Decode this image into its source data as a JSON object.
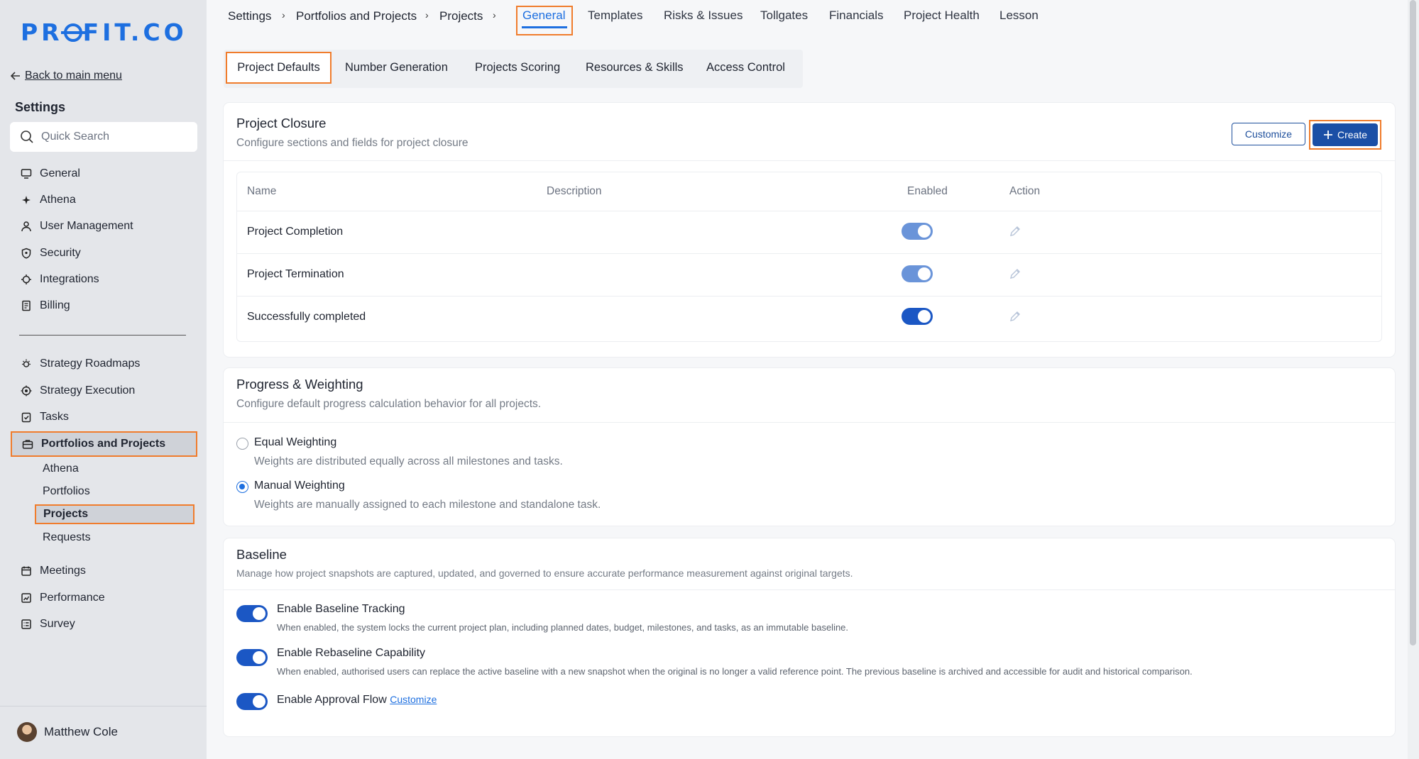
{
  "brand": {
    "logo_text_pre": "PR",
    "logo_text_post": "FIT.CO"
  },
  "sidebar": {
    "back_label": "Back to main menu",
    "title": "Settings",
    "search_placeholder": "Quick Search",
    "items": [
      {
        "label": "General",
        "icon": "monitor-icon"
      },
      {
        "label": "Athena",
        "icon": "sparkle-icon"
      },
      {
        "label": "User Management",
        "icon": "user-icon"
      },
      {
        "label": "Security",
        "icon": "shield-icon"
      },
      {
        "label": "Integrations",
        "icon": "gear-icon"
      },
      {
        "label": "Billing",
        "icon": "receipt-icon"
      }
    ],
    "items2": [
      {
        "label": "Strategy Roadmaps",
        "icon": "lightbulb-icon"
      },
      {
        "label": "Strategy Execution",
        "icon": "target-icon"
      },
      {
        "label": "Tasks",
        "icon": "checklist-icon"
      },
      {
        "label": "Portfolios and Projects",
        "icon": "briefcase-icon"
      }
    ],
    "sub_items": [
      "Athena",
      "Portfolios",
      "Projects",
      "Requests"
    ],
    "items3": [
      {
        "label": "Meetings",
        "icon": "calendar-icon"
      },
      {
        "label": "Performance",
        "icon": "chart-icon"
      },
      {
        "label": "Survey",
        "icon": "survey-icon"
      }
    ],
    "user_name": "Matthew Cole"
  },
  "breadcrumb": [
    "Settings",
    "Portfolios and Projects",
    "Projects"
  ],
  "top_tabs": [
    "General",
    "Templates",
    "Risks & Issues",
    "Tollgates",
    "Financials",
    "Project Health",
    "Lesson"
  ],
  "sub_tabs": [
    "Project Defaults",
    "Number Generation",
    "Projects Scoring",
    "Resources & Skills",
    "Access Control"
  ],
  "closure": {
    "title": "Project Closure",
    "subtitle": "Configure sections and fields for project closure",
    "customize_label": "Customize",
    "create_label": "Create",
    "columns": [
      "Name",
      "Description",
      "Enabled",
      "Action"
    ],
    "rows": [
      {
        "name": "Project Completion",
        "description": "",
        "enabled": true
      },
      {
        "name": "Project Termination",
        "description": "",
        "enabled": true
      },
      {
        "name": "Successfully completed",
        "description": "",
        "enabled": true
      }
    ]
  },
  "progress": {
    "title": "Progress & Weighting",
    "subtitle": "Configure default progress calculation behavior for all projects.",
    "options": [
      {
        "label": "Equal Weighting",
        "desc": "Weights are distributed equally across all milestones and tasks.",
        "selected": false
      },
      {
        "label": "Manual Weighting",
        "desc": "Weights are manually assigned to each milestone and standalone task.",
        "selected": true
      }
    ]
  },
  "baseline": {
    "title": "Baseline",
    "subtitle": "Manage how project snapshots are captured, updated, and governed to ensure accurate performance measurement against original targets.",
    "settings": [
      {
        "label": "Enable Baseline Tracking",
        "desc": "When enabled, the system locks the current project plan, including planned dates, budget, milestones, and tasks, as an immutable baseline.",
        "enabled": true
      },
      {
        "label": "Enable Rebaseline Capability",
        "desc": "When enabled, authorised users can replace the active baseline with a new snapshot when the original is no longer a valid reference point. The previous baseline is archived and accessible for audit and historical comparison.",
        "enabled": true
      },
      {
        "label": "Enable Approval Flow",
        "desc": "",
        "enabled": true,
        "link": "Customize"
      }
    ]
  },
  "colors": {
    "accent": "#1d6fe0",
    "primary_button": "#1b4fa6",
    "highlight": "#f07c2c"
  }
}
